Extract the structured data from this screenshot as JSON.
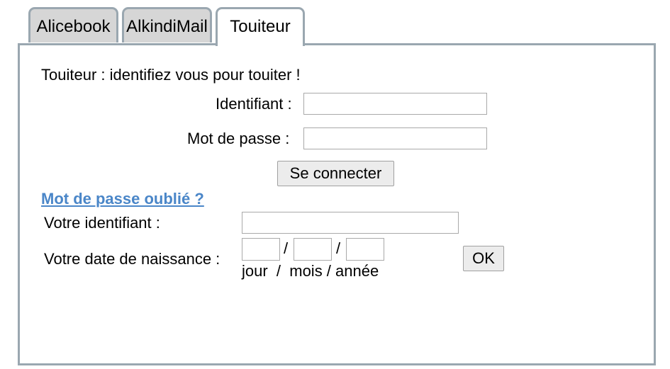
{
  "tabs": [
    {
      "label": "Alicebook",
      "active": false
    },
    {
      "label": "AlkindiMail",
      "active": false
    },
    {
      "label": "Touiteur",
      "active": true
    }
  ],
  "login": {
    "heading": "Touiteur : identifiez vous pour touiter !",
    "username_label": "Identifiant :",
    "username_value": "",
    "password_label": "Mot de passe :",
    "password_value": "",
    "submit_label": "Se connecter"
  },
  "recovery": {
    "link_label": "Mot de passe oublié ?",
    "id_label": "Votre identifiant :",
    "id_value": "",
    "birthdate_label": "Votre date de naissance :",
    "separator": "/",
    "day_value": "",
    "month_value": "",
    "year_value": "",
    "format_hint": "jour  /  mois / année",
    "ok_label": "OK"
  }
}
